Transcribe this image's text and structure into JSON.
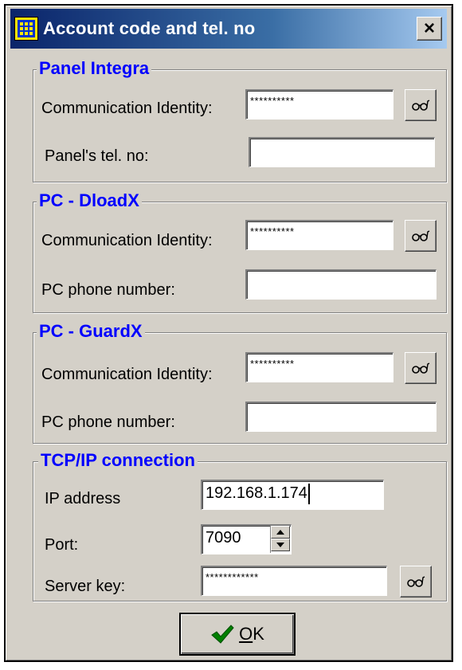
{
  "window": {
    "title": "Account code and tel. no",
    "close_label": "×"
  },
  "groups": {
    "panel_integra": {
      "title": "Panel Integra",
      "comm_label": "Communication Identity:",
      "comm_value": "**********",
      "phone_label": "Panel's tel. no:",
      "phone_value": ""
    },
    "pc_dloadx": {
      "title": "PC - DloadX",
      "comm_label": "Communication Identity:",
      "comm_value": "**********",
      "phone_label": "PC phone number:",
      "phone_value": ""
    },
    "pc_guardx": {
      "title": "PC - GuardX",
      "comm_label": "Communication Identity:",
      "comm_value": "**********",
      "phone_label": "PC phone number:",
      "phone_value": ""
    },
    "tcpip": {
      "title": "TCP/IP connection",
      "ip_label": "IP address",
      "ip_value": "192.168.1.174",
      "port_label": "Port:",
      "port_value": "7090",
      "key_label": "Server key:",
      "key_value": "************"
    }
  },
  "buttons": {
    "ok_first_letter": "O",
    "ok_rest": "K"
  },
  "icons": {
    "app": "keypad-icon",
    "show": "glasses-icon",
    "ok": "checkmark-icon"
  },
  "colors": {
    "titlebar_start": "#0a246a",
    "titlebar_end": "#a6caf0",
    "group_title": "#0000ff",
    "window_bg": "#d4d0c8",
    "checkmark": "#008000"
  }
}
